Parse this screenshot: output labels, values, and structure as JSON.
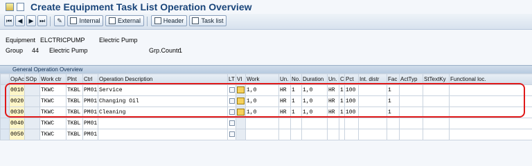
{
  "title": "Create Equipment Task List Operation Overview",
  "toolbar": {
    "internal_label": "Internal",
    "external_label": "External",
    "header_label": "Header",
    "tasklist_label": "Task list"
  },
  "header_fields": {
    "equipment_label": "Equipment",
    "equipment_value": "ELCTRICPUMP",
    "equipment_desc": "Electric Pump",
    "group_label": "Group",
    "group_value": "44",
    "group_desc": "Electric Pump",
    "grp_counter_label": "Grp.Countr",
    "grp_counter_value": "1"
  },
  "panel_title": "General Operation Overview",
  "columns": [
    "OpAc",
    "SOp",
    "Work ctr",
    "Plnt",
    "Ctrl",
    "Operation Description",
    "LT",
    "VI",
    "Work",
    "Un.",
    "No.",
    "Duration",
    "Un.",
    "C",
    "Pct",
    "Int. distr",
    "Fac",
    "ActTyp",
    "StTextKy",
    "Functional loc."
  ],
  "rows": [
    {
      "opac": "0010",
      "sop": "",
      "workctr": "TKWC",
      "plnt": "TKBL",
      "ctrl": "PM01",
      "desc": "Service",
      "work": "1,0",
      "un1": "HR",
      "no": "1",
      "duration": "1,0",
      "un2": "HR",
      "c": "1",
      "pct": "100",
      "fac": "1"
    },
    {
      "opac": "0020",
      "sop": "",
      "workctr": "TKWC",
      "plnt": "TKBL",
      "ctrl": "PM01",
      "desc": "Changing Oil",
      "work": "1,0",
      "un1": "HR",
      "no": "1",
      "duration": "1,0",
      "un2": "HR",
      "c": "1",
      "pct": "100",
      "fac": "1"
    },
    {
      "opac": "0030",
      "sop": "",
      "workctr": "TKWC",
      "plnt": "TKBL",
      "ctrl": "PM01",
      "desc": "Cleaning",
      "work": "1,0",
      "un1": "HR",
      "no": "1",
      "duration": "1,0",
      "un2": "HR",
      "c": "1",
      "pct": "100",
      "fac": "1"
    },
    {
      "opac": "0040",
      "sop": "",
      "workctr": "TKWC",
      "plnt": "TKBL",
      "ctrl": "PM01",
      "desc": "",
      "work": "",
      "un1": "",
      "no": "",
      "duration": "",
      "un2": "",
      "c": "",
      "pct": "",
      "fac": ""
    },
    {
      "opac": "0050",
      "sop": "",
      "workctr": "TKWC",
      "plnt": "TKBL",
      "ctrl": "PM01",
      "desc": "",
      "work": "",
      "un1": "",
      "no": "",
      "duration": "",
      "un2": "",
      "c": "",
      "pct": "",
      "fac": ""
    }
  ],
  "colors": {
    "title": "#19457a",
    "highlight": "#e01818",
    "header_bg": "#d3deea"
  },
  "icons": [
    "first-page-icon",
    "prev-page-icon",
    "next-page-icon",
    "last-page-icon",
    "edit-icon",
    "internal-icon",
    "external-icon",
    "header-icon",
    "task-list-icon",
    "activity-icon"
  ]
}
